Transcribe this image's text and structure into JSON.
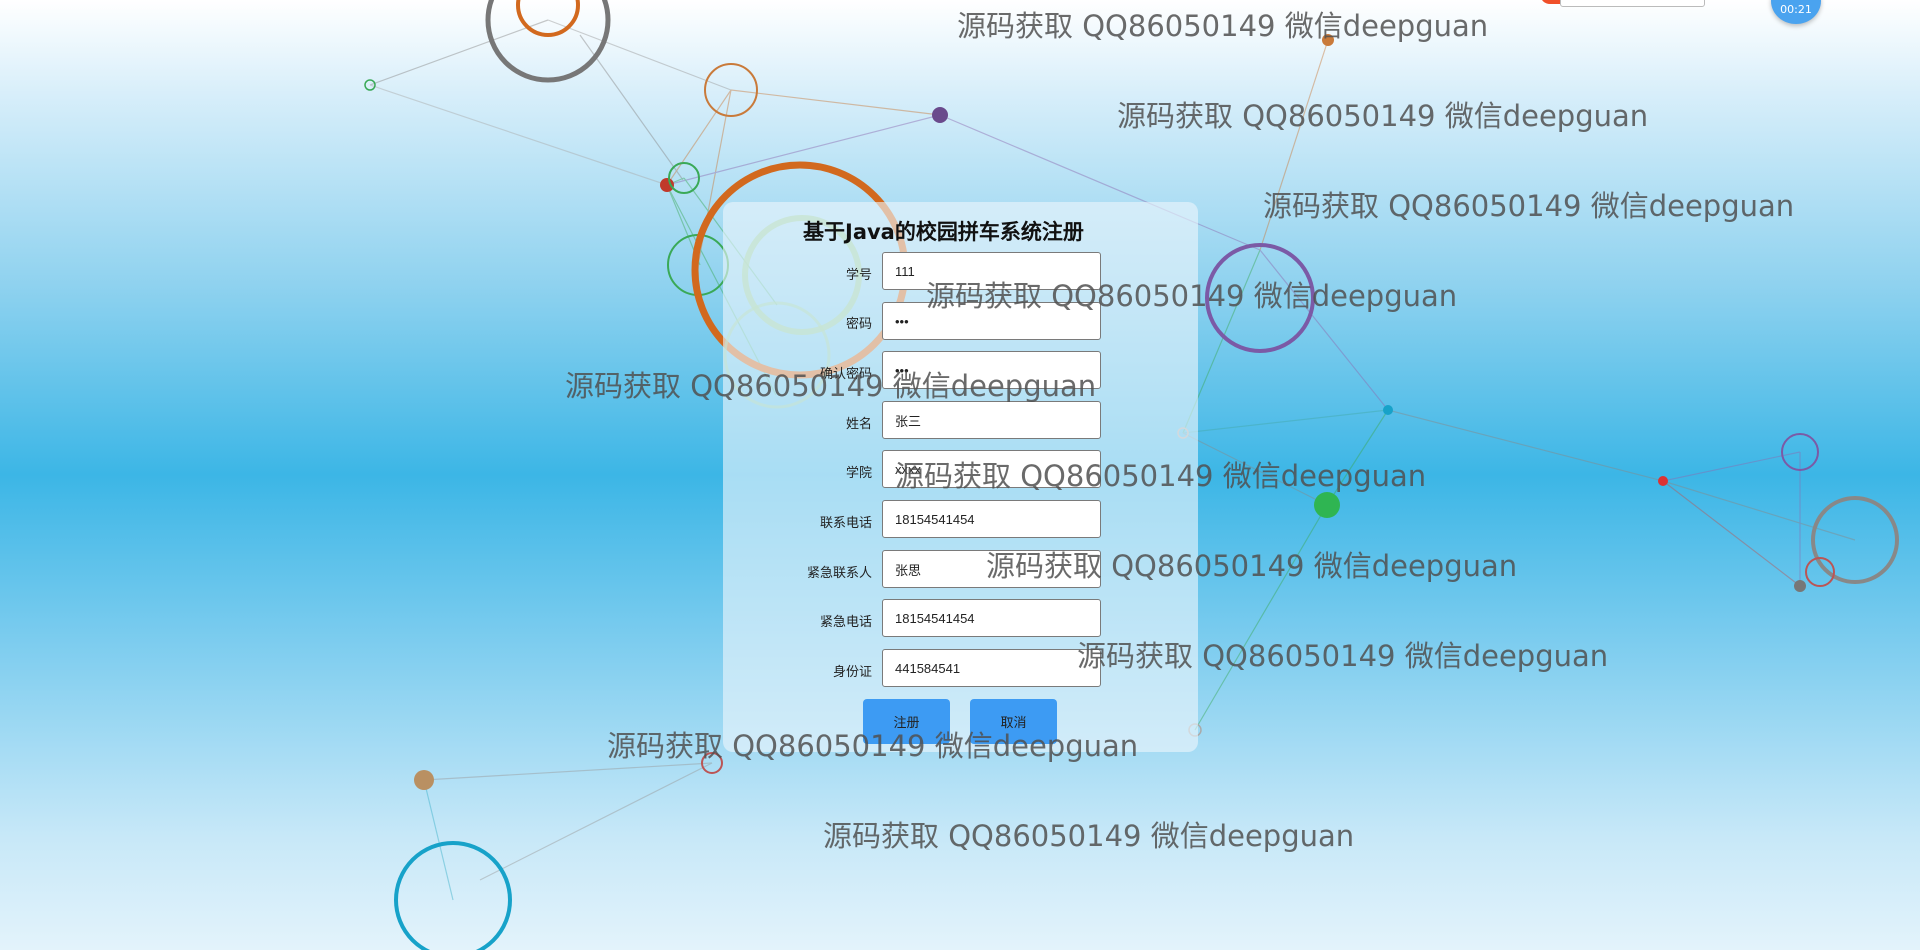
{
  "form": {
    "title": "基于Java的校园拼车系统注册",
    "fields": [
      {
        "label": "学号",
        "value": "111"
      },
      {
        "label": "密码",
        "value": "•••"
      },
      {
        "label": "确认密码",
        "value": "•••"
      },
      {
        "label": "姓名",
        "value": "张三"
      },
      {
        "label": "学院",
        "value": "xxxx"
      },
      {
        "label": "联系电话",
        "value": "18154541454"
      },
      {
        "label": "紧急联系人",
        "value": "张思"
      },
      {
        "label": "紧急电话",
        "value": "18154541454"
      },
      {
        "label": "身份证",
        "value": "441584541"
      }
    ],
    "register_label": "注册",
    "cancel_label": "取消"
  },
  "watermark": "源码获取 QQ86050149 微信deepguan",
  "clock": {
    "time": "00:21"
  },
  "colors": {
    "button": "#3d9bf3",
    "background": "#3cb6e6"
  }
}
